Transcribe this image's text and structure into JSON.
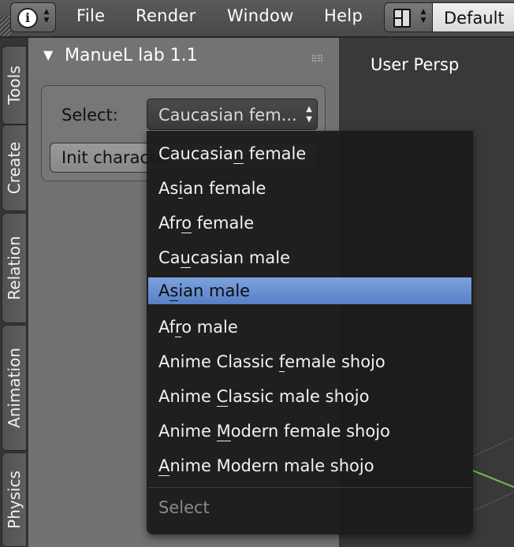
{
  "header": {
    "menus": [
      "File",
      "Render",
      "Window",
      "Help"
    ],
    "screen_layout": "Default"
  },
  "tabs": [
    "Tools",
    "Create",
    "Relation",
    "Animation",
    "Physics"
  ],
  "panel": {
    "title": "ManueL lab 1.1",
    "select_label": "Select:",
    "select_value": "Caucasian fem...",
    "init_button": "Init character"
  },
  "viewport": {
    "label": "User Persp"
  },
  "dropdown": {
    "items": [
      {
        "label": "Caucasian female",
        "pre": "Caucasia",
        "ul": "n",
        "post": " female",
        "selected": false
      },
      {
        "label": "Asian female",
        "pre": "As",
        "ul": "i",
        "post": "an female",
        "selected": false
      },
      {
        "label": "Afro female",
        "pre": "Afr",
        "ul": "o",
        "post": " female",
        "selected": false
      },
      {
        "label": "Caucasian male",
        "pre": "Ca",
        "ul": "u",
        "post": "casian male",
        "selected": false
      },
      {
        "label": "Asian male",
        "pre": "A",
        "ul": "s",
        "post": "ian male",
        "selected": true
      },
      {
        "label": "Afro male",
        "pre": "Af",
        "ul": "r",
        "post": "o male",
        "selected": false
      },
      {
        "label": "Anime Classic female shojo",
        "pre": "Anime Classic ",
        "ul": "f",
        "post": "emale shojo",
        "selected": false
      },
      {
        "label": "Anime Classic male shojo",
        "pre": "Anime ",
        "ul": "C",
        "post": "lassic male shojo",
        "selected": false
      },
      {
        "label": "Anime Modern female shojo",
        "pre": "Anime ",
        "ul": "M",
        "post": "odern female shojo",
        "selected": false
      },
      {
        "label": "Anime Modern male shojo",
        "pre": "",
        "ul": "A",
        "post": "nime Modern male shojo",
        "selected": false
      }
    ],
    "title": "Select"
  },
  "colors": {
    "highlight": "#5880c6",
    "menu_background": "#1a1a1a",
    "panel_background": "#727272"
  }
}
